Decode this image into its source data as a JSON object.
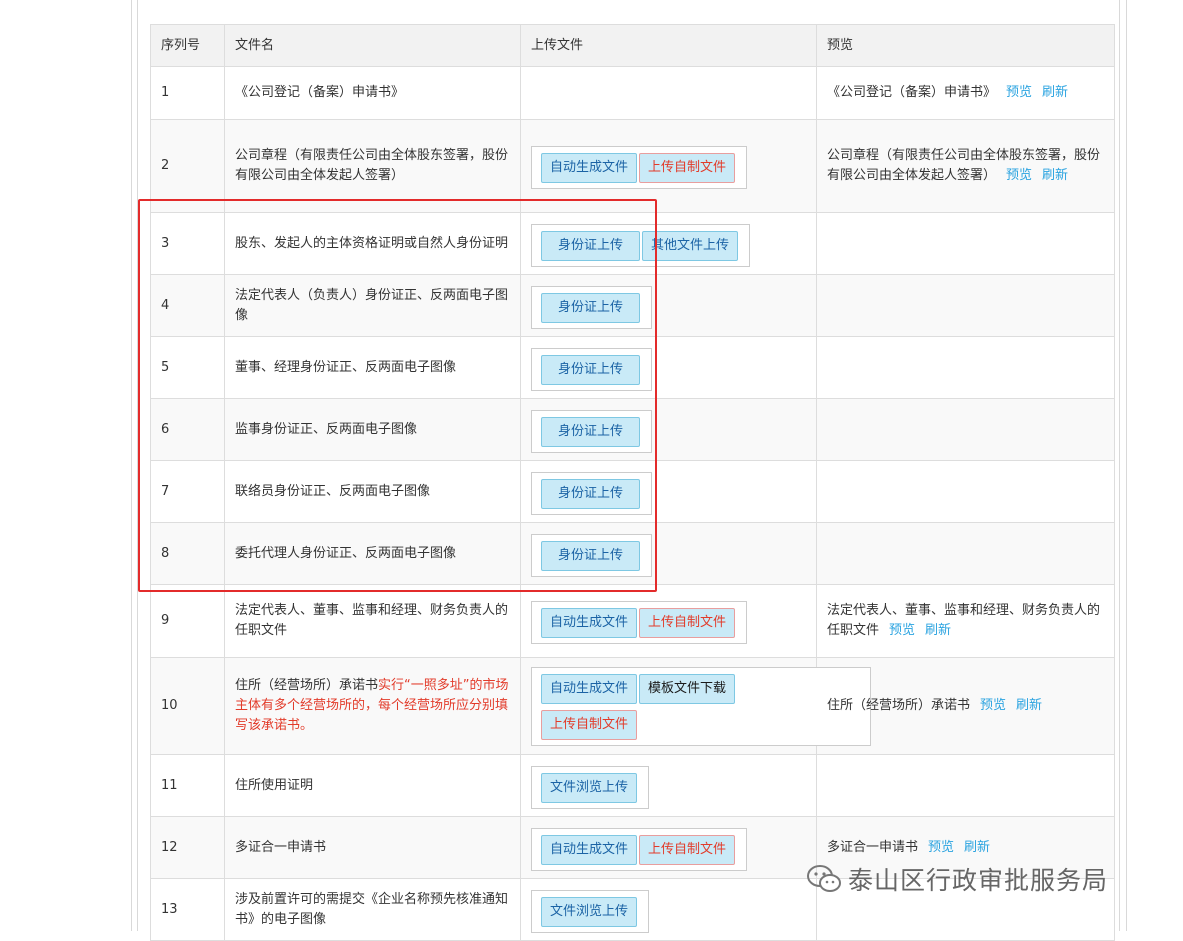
{
  "table": {
    "headers": {
      "seq": "序列号",
      "name": "文件名",
      "upload": "上传文件",
      "preview": "预览"
    },
    "rows": [
      {
        "seq": "1",
        "name": "《公司登记（备案）申请书》",
        "preview_text": "《公司登记（备案）申请书》",
        "preview_link": "预览",
        "refresh_link": "刷新"
      },
      {
        "seq": "2",
        "name": "公司章程（有限责任公司由全体股东签署，股份有限公司由全体发起人签署）",
        "btn_auto": "自动生成文件",
        "btn_self": "上传自制文件",
        "preview_text": "公司章程（有限责任公司由全体股东签署，股份有限公司由全体发起人签署）",
        "preview_link": "预览",
        "refresh_link": "刷新"
      },
      {
        "seq": "3",
        "name": "股东、发起人的主体资格证明或自然人身份证明",
        "btn_id": "身份证上传",
        "btn_other": "其他文件上传"
      },
      {
        "seq": "4",
        "name": "法定代表人（负责人）身份证正、反两面电子图像",
        "btn_id": "身份证上传"
      },
      {
        "seq": "5",
        "name": "董事、经理身份证正、反两面电子图像",
        "btn_id": "身份证上传"
      },
      {
        "seq": "6",
        "name": "监事身份证正、反两面电子图像",
        "btn_id": "身份证上传"
      },
      {
        "seq": "7",
        "name": "联络员身份证正、反两面电子图像",
        "btn_id": "身份证上传"
      },
      {
        "seq": "8",
        "name": "委托代理人身份证正、反两面电子图像",
        "btn_id": "身份证上传"
      },
      {
        "seq": "9",
        "name": "法定代表人、董事、监事和经理、财务负责人的任职文件",
        "btn_auto": "自动生成文件",
        "btn_self": "上传自制文件",
        "preview_text": "法定代表人、董事、监事和经理、财务负责人的任职文件",
        "preview_link": "预览",
        "refresh_link": "刷新"
      },
      {
        "seq": "10",
        "name": "住所（经营场所）承诺书",
        "name_note": "实行“一照多址”的市场主体有多个经营场所的，每个经营场所应分别填写该承诺书。",
        "btn_auto": "自动生成文件",
        "btn_template": "模板文件下载",
        "btn_self": "上传自制文件",
        "preview_text": "住所（经营场所）承诺书",
        "preview_link": "预览",
        "refresh_link": "刷新"
      },
      {
        "seq": "11",
        "name": "住所使用证明",
        "btn_browse": "文件浏览上传"
      },
      {
        "seq": "12",
        "name": "多证合一申请书",
        "btn_auto": "自动生成文件",
        "btn_self": "上传自制文件",
        "preview_text": "多证合一申请书",
        "preview_link": "预览",
        "refresh_link": "刷新"
      },
      {
        "seq": "13",
        "name": "涉及前置许可的需提交《企业名称预先核准通知书》的电子图像",
        "btn_browse": "文件浏览上传"
      }
    ]
  },
  "watermark": {
    "text": "泰山区行政审批服务局",
    "icon": "wechat-icon"
  },
  "colors": {
    "highlight": "#e32b2b",
    "button_bg": "#c9eaf7",
    "button_text": "#1b63a5",
    "link": "#2aa3e0",
    "note_red": "#e23b2a"
  }
}
